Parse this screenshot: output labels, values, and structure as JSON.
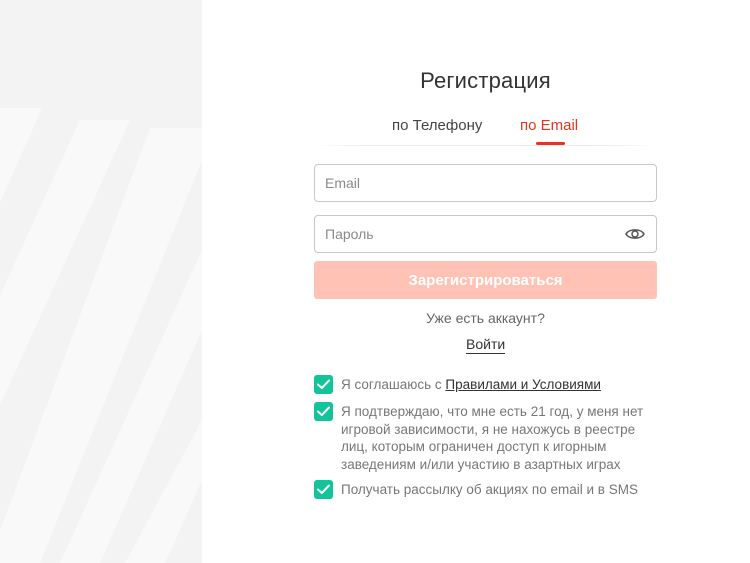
{
  "form": {
    "title": "Регистрация",
    "tabs": {
      "phone": "по Телефону",
      "email": "по Email"
    },
    "active_tab": "email",
    "email_placeholder": "Email",
    "password_placeholder": "Пароль",
    "submit_label": "Зарегистрироваться",
    "have_account_text": "Уже есть аккаунт?",
    "login_label": "Войти"
  },
  "checkboxes": {
    "terms_prefix": "Я соглашаюсь с ",
    "terms_link": "Правилами и Условиями",
    "age_text": "Я подтверждаю, что мне есть 21 год, у меня нет игровой зависимости, я не нахожусь в реестре лиц, которым ограничен доступ к игорным заведениям и/или участию в азартных играх",
    "newsletter_text": "Получать рассылку об акциях по email и в SMS"
  },
  "colors": {
    "accent": "#e8341c",
    "submit_bg": "#ffc2b5",
    "check_bg": "#13c49a"
  },
  "icons": {
    "password_toggle": "eye-icon",
    "checkbox": "checkmark-icon"
  }
}
